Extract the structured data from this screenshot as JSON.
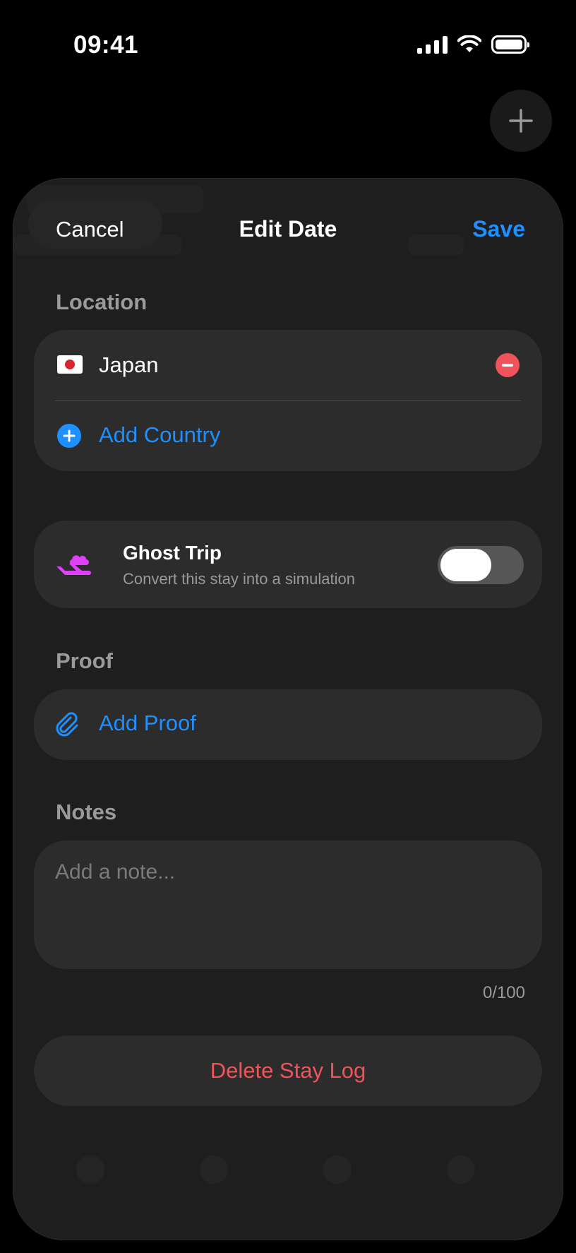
{
  "status_bar": {
    "time": "09:41",
    "icons": [
      "signal-icon",
      "wifi-icon",
      "battery-icon"
    ]
  },
  "fab": {
    "icon": "plus-icon"
  },
  "nav": {
    "cancel_label": "Cancel",
    "title": "Edit Date",
    "save_label": "Save",
    "accent_color": "#1e90ff"
  },
  "location": {
    "section_label": "Location",
    "countries": [
      {
        "name": "Japan",
        "flag": "japan-flag-icon"
      }
    ],
    "add_country_label": "Add Country"
  },
  "ghost_trip": {
    "title": "Ghost Trip",
    "subtitle": "Convert this stay into a simulation",
    "icon": "plane-cloud-icon",
    "icon_color": "#e040fb",
    "enabled": false
  },
  "proof": {
    "section_label": "Proof",
    "add_proof_label": "Add Proof",
    "icon": "paperclip-icon"
  },
  "notes": {
    "section_label": "Notes",
    "placeholder": "Add a note...",
    "value": "",
    "char_count": "0/100"
  },
  "delete": {
    "label": "Delete Stay Log",
    "color": "#f0545a"
  }
}
